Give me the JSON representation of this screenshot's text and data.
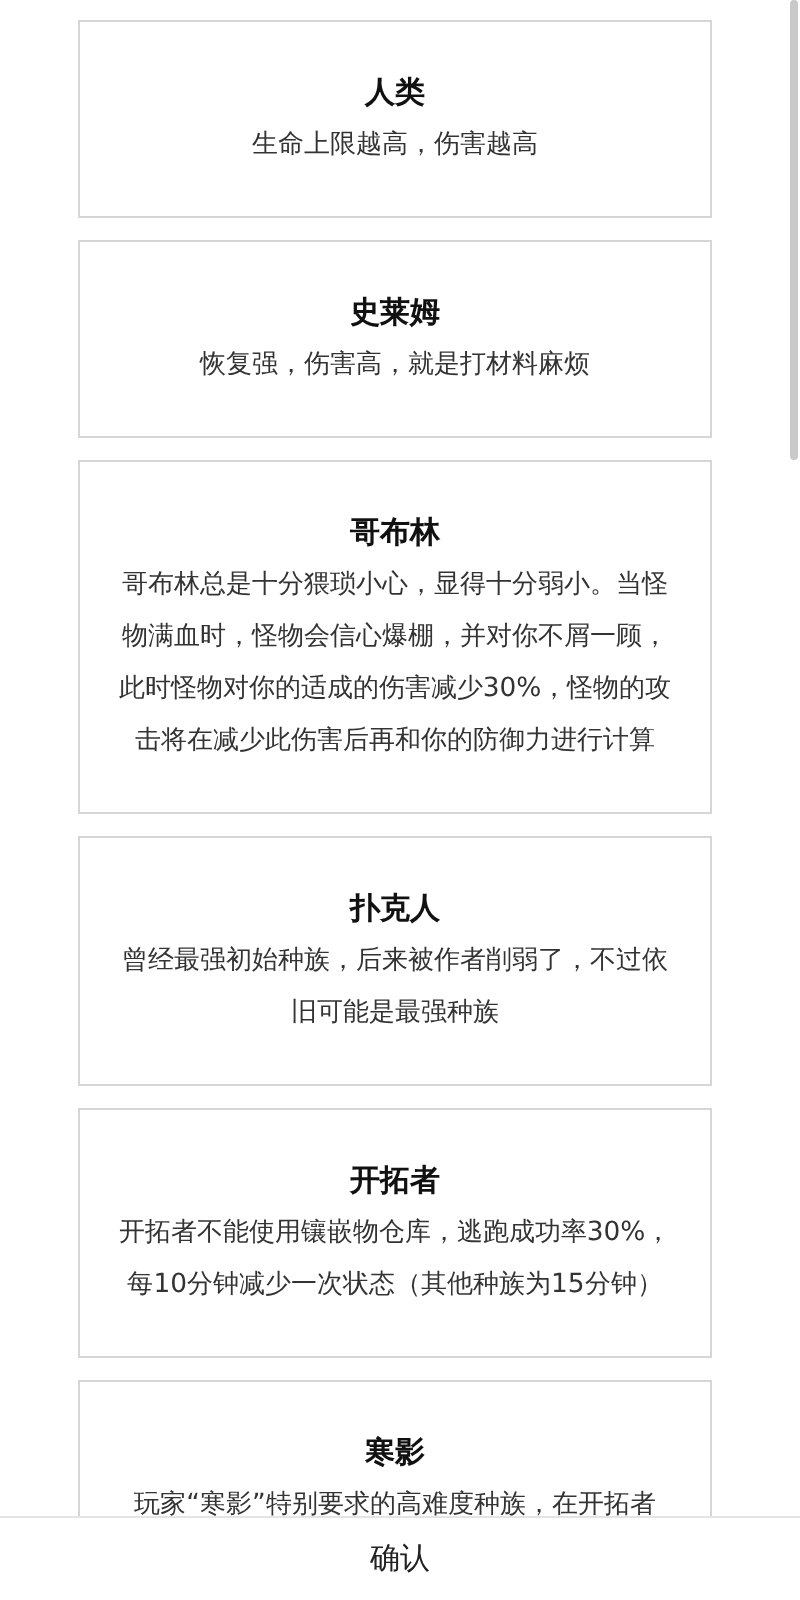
{
  "races": [
    {
      "name": "人类",
      "description": "生命上限越高，伤害越高"
    },
    {
      "name": "史莱姆",
      "description": "恢复强，伤害高，就是打材料麻烦"
    },
    {
      "name": "哥布林",
      "description": "哥布林总是十分猥琐小心，显得十分弱小。当怪物满血时，怪物会信心爆棚，并对你不屑一顾，此时怪物对你的适成的伤害减少30%，怪物的攻击将在减少此伤害后再和你的防御力进行计算"
    },
    {
      "name": "扑克人",
      "description": "曾经最强初始种族，后来被作者削弱了，不过依旧可能是最强种族"
    },
    {
      "name": "开拓者",
      "description": "开拓者不能使用镶嵌物仓库，逃跑成功率30%，每10分钟减少一次状态（其他种族为15分钟）"
    },
    {
      "name": "寒影",
      "description": "玩家“寒影”特别要求的高难度种族，在开拓者"
    }
  ],
  "confirm_button": "确认"
}
